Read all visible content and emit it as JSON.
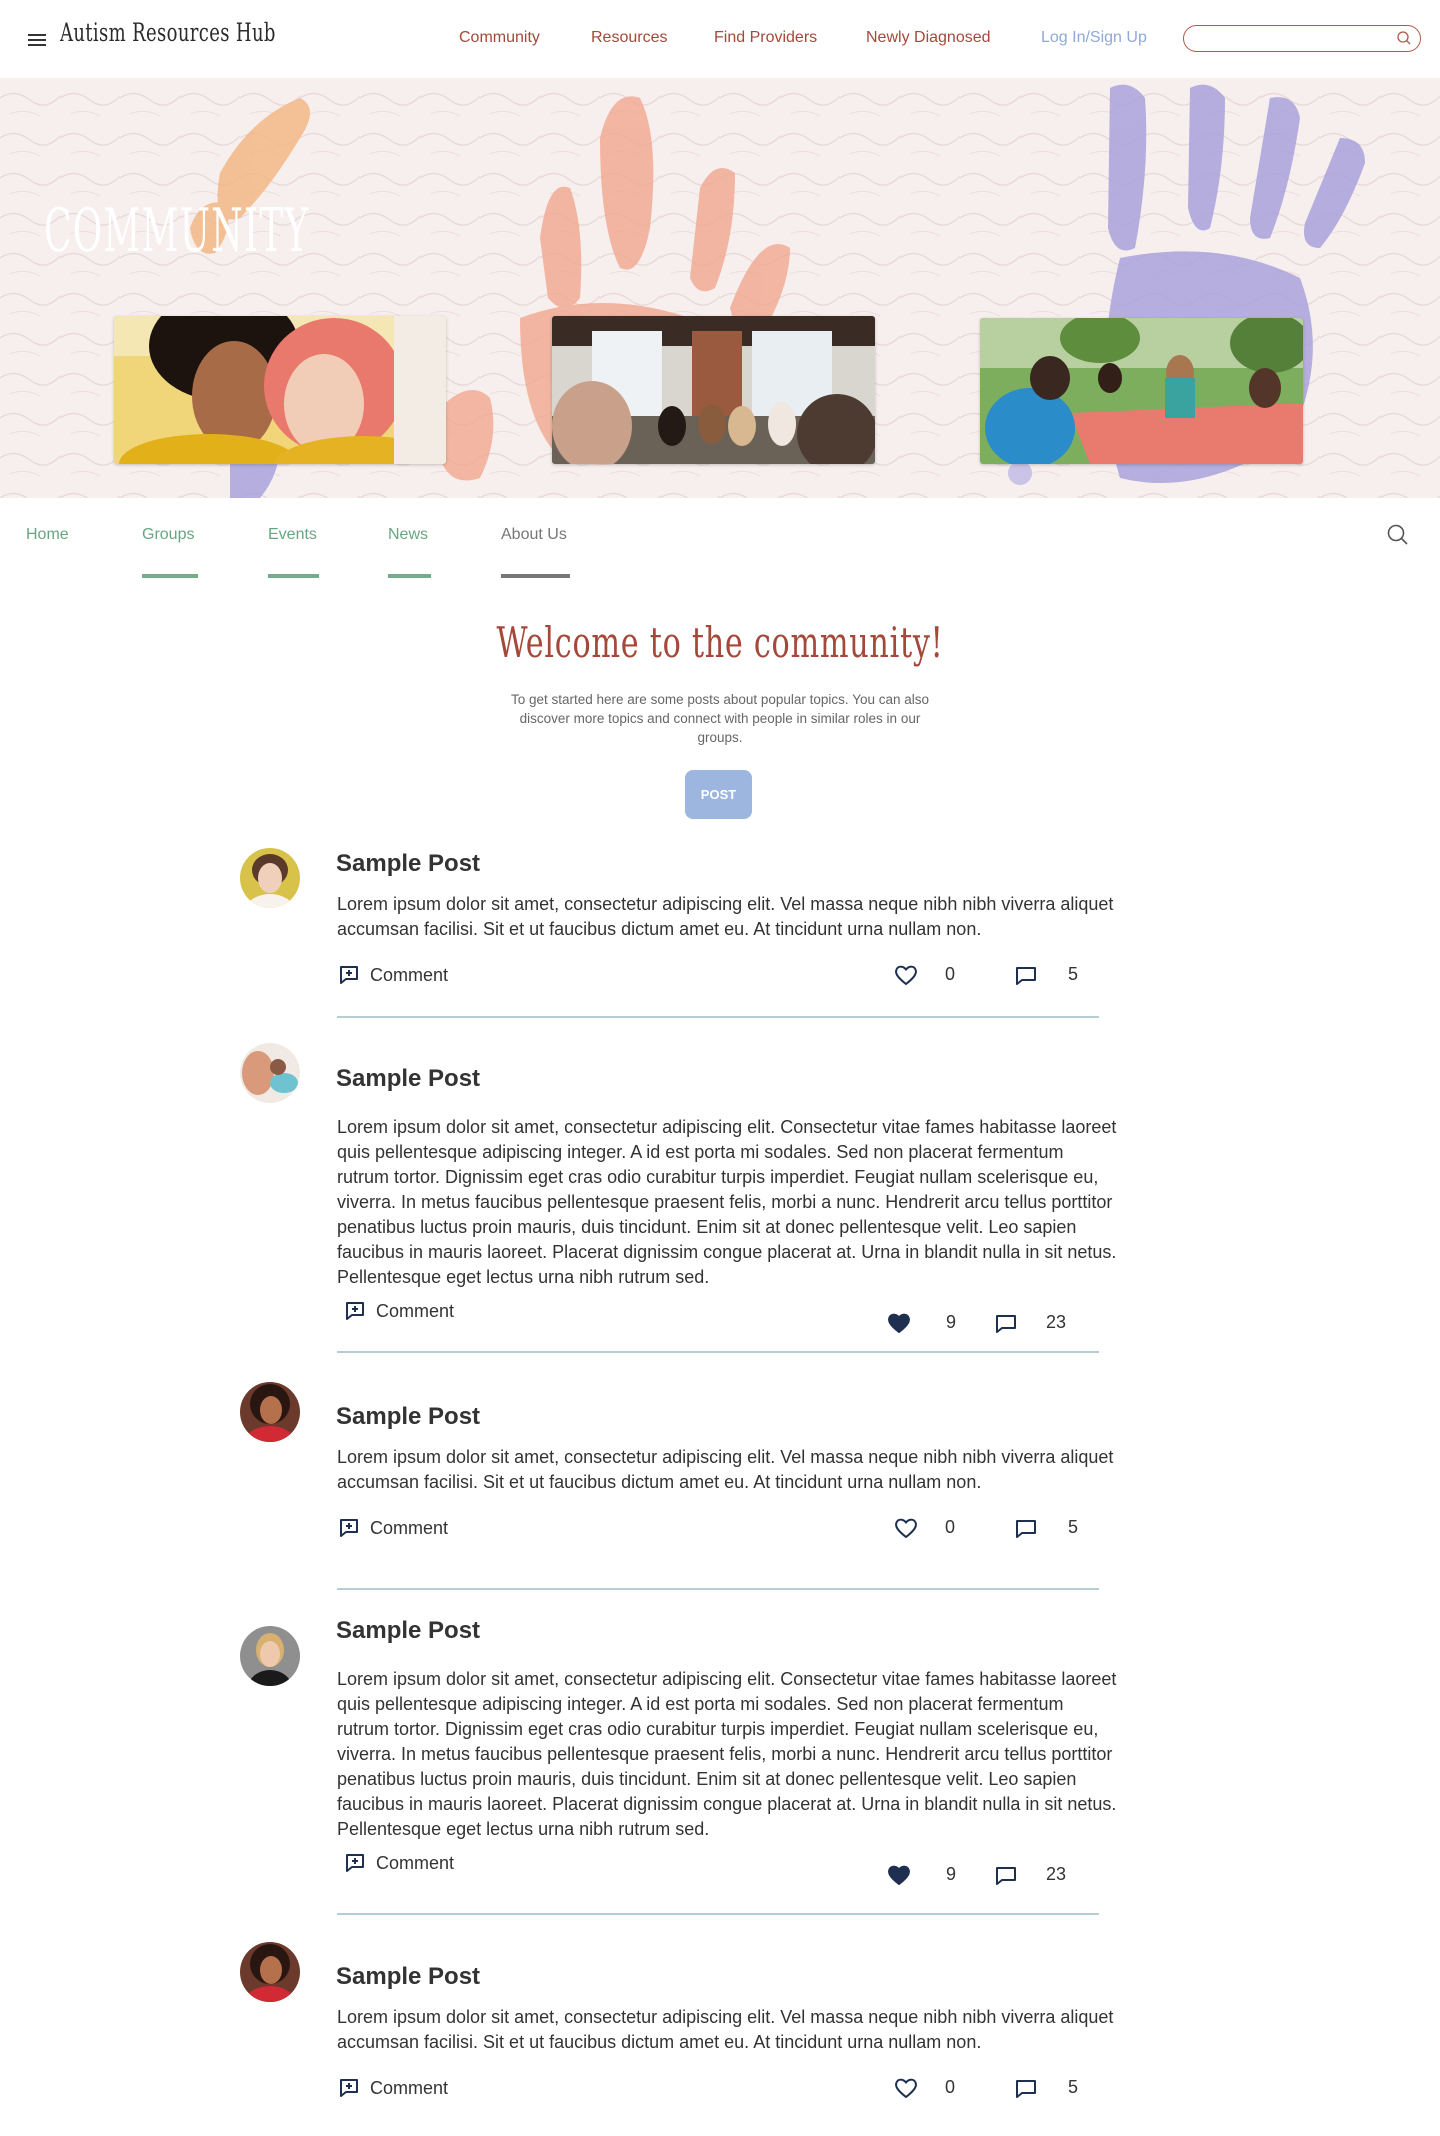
{
  "header": {
    "brand": "Autism Resources Hub",
    "nav": [
      "Community",
      "Resources",
      "Find Providers",
      "Newly Diagnosed"
    ],
    "login": "Log In/Sign Up",
    "search_placeholder": ""
  },
  "hero": {
    "title": "COMMUNITY"
  },
  "subnav": {
    "items": [
      "Home",
      "Groups",
      "Events",
      "News",
      "About Us"
    ]
  },
  "welcome": {
    "title": "Welcome to the community!",
    "text": "To get started here are some posts about popular topics. You can also discover more topics and connect with people in similar roles in our groups.",
    "post_button": "POST"
  },
  "comment_label": "Comment",
  "posts": [
    {
      "title": "Sample Post",
      "body": "Lorem ipsum dolor sit amet, consectetur adipiscing elit. Vel massa neque nibh nibh viverra aliquet accumsan facilisi. Sit et ut faucibus dictum amet eu. At tincidunt urna nullam non.",
      "likes": "0",
      "liked": false,
      "comments": "5"
    },
    {
      "title": "Sample Post",
      "body": "Lorem ipsum dolor sit amet, consectetur adipiscing elit. Consectetur vitae fames habitasse laoreet quis pellentesque adipiscing integer. A id est porta mi sodales. Sed non placerat fermentum rutrum tortor. Dignissim eget cras odio curabitur turpis imperdiet. Feugiat nullam scelerisque eu, viverra. In metus faucibus pellentesque praesent felis, morbi a nunc. Hendrerit arcu tellus porttitor penatibus luctus proin mauris, duis tincidunt. Enim sit at donec pellentesque velit. Leo sapien faucibus in mauris laoreet. Placerat dignissim congue placerat at. Urna in blandit nulla in sit netus. Pellentesque eget lectus urna nibh rutrum sed.",
      "likes": "9",
      "liked": true,
      "comments": "23"
    },
    {
      "title": "Sample Post",
      "body": "Lorem ipsum dolor sit amet, consectetur adipiscing elit. Vel massa neque nibh nibh viverra aliquet accumsan facilisi. Sit et ut faucibus dictum amet eu. At tincidunt urna nullam non.",
      "likes": "0",
      "liked": false,
      "comments": "5"
    },
    {
      "title": "Sample Post",
      "body": "Lorem ipsum dolor sit amet, consectetur adipiscing elit. Consectetur vitae fames habitasse laoreet quis pellentesque adipiscing integer. A id est porta mi sodales. Sed non placerat fermentum rutrum tortor. Dignissim eget cras odio curabitur turpis imperdiet. Feugiat nullam scelerisque eu, viverra. In metus faucibus pellentesque praesent felis, morbi a nunc. Hendrerit arcu tellus porttitor penatibus luctus proin mauris, duis tincidunt. Enim sit at donec pellentesque velit. Leo sapien faucibus in mauris laoreet. Placerat dignissim congue placerat at. Urna in blandit nulla in sit netus. Pellentesque eget lectus urna nibh rutrum sed.",
      "likes": "9",
      "liked": true,
      "comments": "23"
    },
    {
      "title": "Sample Post",
      "body": "Lorem ipsum dolor sit amet, consectetur adipiscing elit. Vel massa neque nibh nibh viverra aliquet accumsan facilisi. Sit et ut faucibus dictum amet eu. At tincidunt urna nullam non.",
      "likes": "0",
      "liked": false,
      "comments": "5"
    }
  ],
  "colors": {
    "brand_red": "#a4493a",
    "nav_green": "#6aa583",
    "link_blue": "#8fa9d6",
    "button_blue": "#9db6e0",
    "heart_navy": "#1f2f4f"
  }
}
